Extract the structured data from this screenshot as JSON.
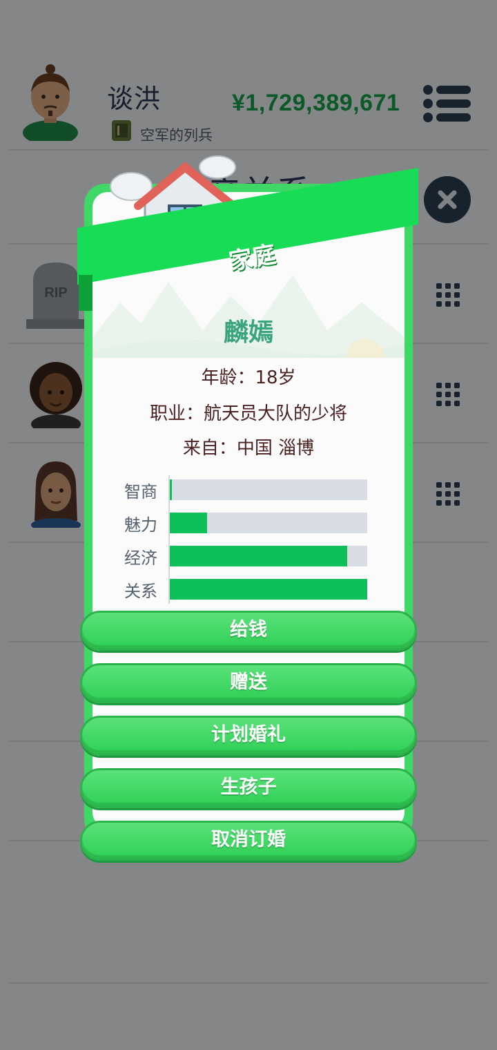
{
  "header": {
    "player_name": "谈洪",
    "rank": "空军的列兵",
    "money": "¥1,729,389,671",
    "menu_icon": "hamburger-menu-icon"
  },
  "background": {
    "section_title": "亲关系",
    "close_icon": "close-icon",
    "grid_icon": "grid-icon",
    "tombstone_text": "RIP"
  },
  "modal": {
    "banner_title": "家庭",
    "partner_name": "麟嫣",
    "age_line": "年龄：18岁",
    "job_line": "职业：航天员大队的少将",
    "origin_line": "来自：中国 淄博",
    "stats": [
      {
        "label": "智商",
        "value": 0.01
      },
      {
        "label": "魅力",
        "value": 0.19
      },
      {
        "label": "经济",
        "value": 0.9
      },
      {
        "label": "关系",
        "value": 1.0
      }
    ],
    "buttons": [
      "给钱",
      "赠送",
      "计划婚礼",
      "生孩子",
      "取消订婚"
    ]
  },
  "colors": {
    "accent_green": "#3fd765",
    "money_green": "#17a34a",
    "bar_fill": "#0fbf5a",
    "name_teal": "#3aa57a"
  }
}
